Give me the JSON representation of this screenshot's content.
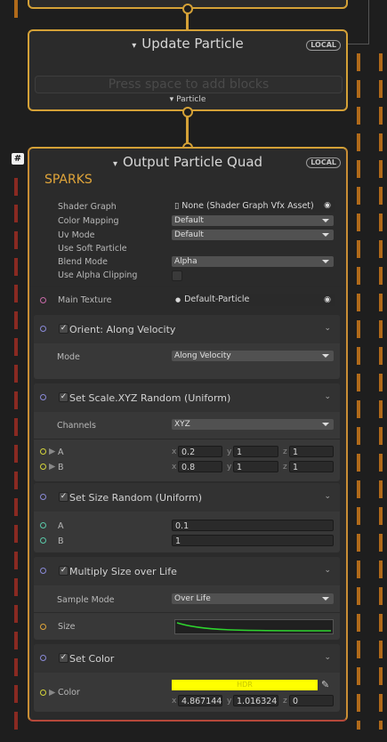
{
  "update_context": {
    "title": "Update Particle",
    "badge": "LOCAL",
    "placeholder": "Press space to add blocks",
    "flow_label": "Particle"
  },
  "output_context": {
    "title": "Output Particle Quad",
    "badge": "LOCAL",
    "hash": "#",
    "system_name": "SPARKS",
    "settings": {
      "shader_graph_label": "Shader Graph",
      "shader_graph_value": "None (Shader Graph Vfx Asset)",
      "color_mapping_label": "Color Mapping",
      "color_mapping_value": "Default",
      "uv_mode_label": "Uv Mode",
      "uv_mode_value": "Default",
      "soft_particle_label": "Use Soft Particle",
      "blend_mode_label": "Blend Mode",
      "blend_mode_value": "Alpha",
      "alpha_clipping_label": "Use Alpha Clipping"
    },
    "main_texture_label": "Main Texture",
    "main_texture_value": "Default-Particle"
  },
  "blocks": {
    "orient": {
      "title": "Orient: Along Velocity",
      "mode_label": "Mode",
      "mode_value": "Along Velocity"
    },
    "scale": {
      "title": "Set Scale.XYZ Random (Uniform)",
      "channels_label": "Channels",
      "channels_value": "XYZ",
      "a_label": "A",
      "a_x": "0.2",
      "a_y": "1",
      "a_z": "1",
      "b_label": "B",
      "b_x": "0.8",
      "b_y": "1",
      "b_z": "1"
    },
    "size": {
      "title": "Set Size Random (Uniform)",
      "a_label": "A",
      "a_value": "0.1",
      "b_label": "B",
      "b_value": "1"
    },
    "multiply": {
      "title": "Multiply Size over Life",
      "sample_label": "Sample Mode",
      "sample_value": "Over Life",
      "size_label": "Size"
    },
    "color": {
      "title": "Set Color",
      "color_label": "Color",
      "hdr": "HDR",
      "x": "4.867144",
      "y": "1.016324",
      "z": "0",
      "swatch": "#ffff00"
    }
  },
  "axis": {
    "x": "x",
    "y": "y",
    "z": "z"
  },
  "colors": {
    "context_border": "#d4a137",
    "context_border_red": "#b5483a",
    "port_vec": "#d4d43a",
    "port_float": "#5ac9a8",
    "port_tex": "#c86aa8",
    "port_flow": "#8a8ad8",
    "curve": "#2ed42e"
  }
}
